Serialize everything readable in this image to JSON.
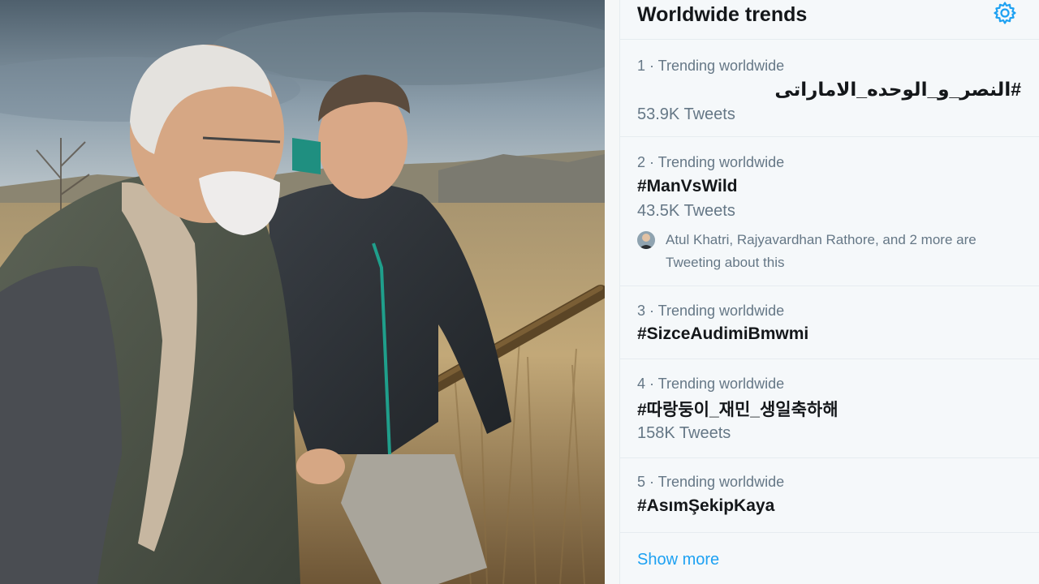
{
  "trends": {
    "title": "Worldwide trends",
    "settings_icon": "gear-icon",
    "accent_color": "#1da1f2",
    "items": [
      {
        "context": "1 · Trending worldwide",
        "name": "#النصر_و_الوحده_الاماراتی",
        "count": "53.9K Tweets"
      },
      {
        "context": "2 · Trending worldwide",
        "name": "#ManVsWild",
        "count": "43.5K Tweets",
        "social_context": "Atul Khatri, Rajyavardhan Rathore, and 2 more are Tweeting about this"
      },
      {
        "context": "3 · Trending worldwide",
        "name": "#SizceAudimiBmwmi"
      },
      {
        "context": "4 · Trending worldwide",
        "name": "#따랑둥이_재민_생일축하해",
        "count": "158K Tweets"
      },
      {
        "context": "5 · Trending worldwide",
        "name": "#AsımŞekipKaya"
      }
    ],
    "show_more": "Show more"
  }
}
